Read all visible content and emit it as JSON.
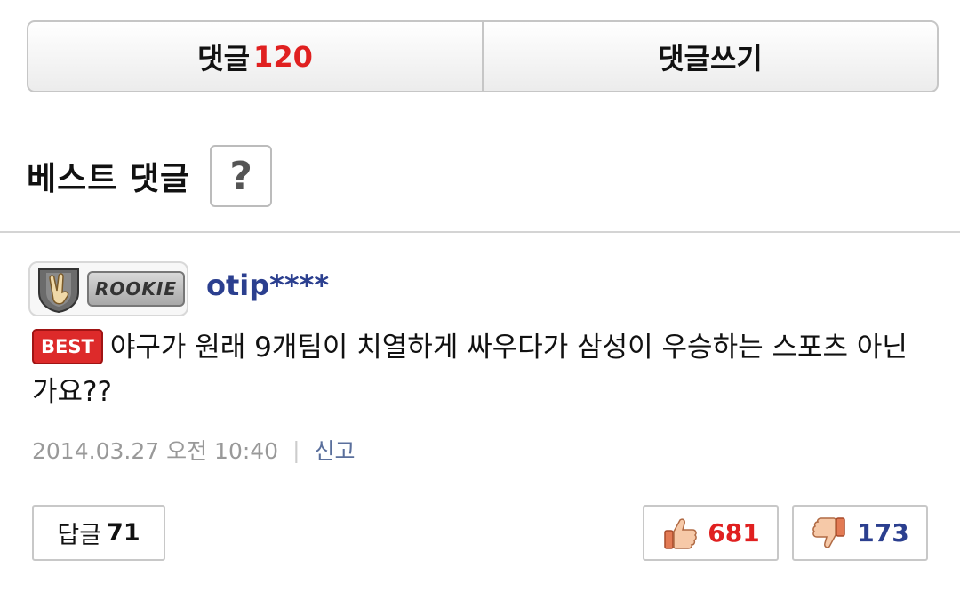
{
  "tabs": {
    "comments_label": "댓글",
    "comments_count": "120",
    "write_label": "댓글쓰기"
  },
  "best_section": {
    "title": "베스트 댓글",
    "help_symbol": "?"
  },
  "comment": {
    "badge_text": "ROOKIE",
    "badge_icon": "victory-hand-icon",
    "username": "otip****",
    "best_tag": "BEST",
    "text": "야구가 원래 9개팀이 치열하게 싸우다가 삼성이 우승하는 스포츠 아닌가요??",
    "timestamp": "2014.03.27 오전 10:40",
    "separator": "|",
    "report_label": "신고",
    "reply_label": "답글",
    "reply_count": "71",
    "likes": "681",
    "dislikes": "173",
    "like_icon": "thumbs-up-icon",
    "dislike_icon": "thumbs-down-icon",
    "colors": {
      "count_red": "#e02020",
      "username_blue": "#2b3f8f",
      "best_red": "#dd2a2a"
    }
  }
}
